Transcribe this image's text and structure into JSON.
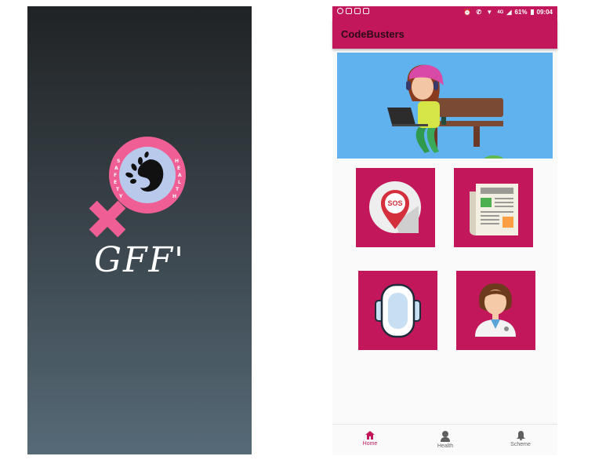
{
  "splash": {
    "title": "GFF'",
    "logo_ring_text_left": "SAFETY",
    "logo_ring_text_right": "HEALTH"
  },
  "status_bar": {
    "network": "4G",
    "battery": "61%",
    "time": "09:04"
  },
  "app_bar": {
    "title": "CodeBusters"
  },
  "tiles": [
    {
      "name": "sos",
      "icon": "sos-pin-icon",
      "badge": "SOS"
    },
    {
      "name": "news",
      "icon": "newspaper-icon"
    },
    {
      "name": "sanitary-pad",
      "icon": "sanitary-pad-icon"
    },
    {
      "name": "doctor",
      "icon": "doctor-icon"
    }
  ],
  "bottom_nav": [
    {
      "label": "Home",
      "icon": "home-icon",
      "active": true
    },
    {
      "label": "Health",
      "icon": "person-icon",
      "active": false
    },
    {
      "label": "Scheme",
      "icon": "bell-icon",
      "active": false
    }
  ],
  "colors": {
    "primary": "#c2185b",
    "splash_top": "#202325",
    "splash_bottom": "#566a77",
    "logo_pink": "#ef5f95",
    "banner_sky": "#5fb2ee"
  }
}
